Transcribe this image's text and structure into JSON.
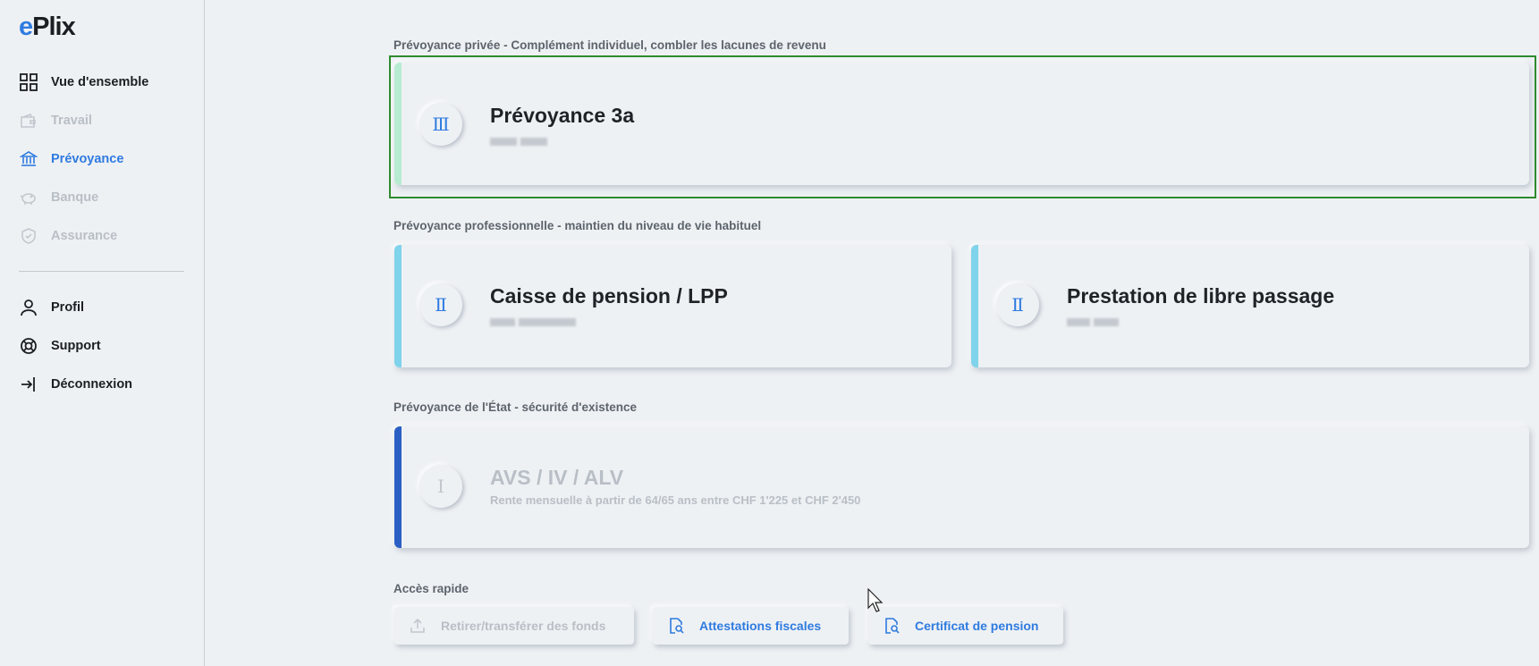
{
  "brand": {
    "logo_e": "e",
    "logo_rest": "Plix",
    "accent_color": "#2f7be0",
    "strip_color": "#a6e22a"
  },
  "sidebar": {
    "items": [
      {
        "label": "Vue d'ensemble",
        "icon": "grid-icon",
        "state": "normal"
      },
      {
        "label": "Travail",
        "icon": "wallet-icon",
        "state": "disabled"
      },
      {
        "label": "Prévoyance",
        "icon": "bank-icon",
        "state": "active"
      },
      {
        "label": "Banque",
        "icon": "piggy-bank-icon",
        "state": "disabled"
      },
      {
        "label": "Assurance",
        "icon": "shield-check-icon",
        "state": "disabled"
      }
    ],
    "bottom_items": [
      {
        "label": "Profil",
        "icon": "user-icon"
      },
      {
        "label": "Support",
        "icon": "lifebuoy-icon"
      },
      {
        "label": "Déconnexion",
        "icon": "logout-icon"
      }
    ]
  },
  "sections": {
    "private": {
      "label": "Prévoyance privée - Complément individuel, combler les lacunes de revenu",
      "card": {
        "title": "Prévoyance 3a",
        "pillar": "Ⅲ",
        "bar_color": "#b8ecd2"
      }
    },
    "professional": {
      "label": "Prévoyance professionnelle - maintien du niveau de vie habituel",
      "cards": [
        {
          "title": "Caisse de pension / LPP",
          "pillar": "Ⅱ",
          "bar_color": "#7fd3ea"
        },
        {
          "title": "Prestation de libre passage",
          "pillar": "Ⅱ",
          "bar_color": "#7fd3ea"
        }
      ]
    },
    "state": {
      "label": "Prévoyance de l'État - sécurité d'existence",
      "card": {
        "title": "AVS / IV / ALV",
        "pillar": "Ⅰ",
        "subtitle": "Rente mensuelle à partir de 64/65 ans entre CHF 1'225 et CHF 2'450",
        "bar_color": "#2b5fc4"
      }
    }
  },
  "quick_access": {
    "label": "Accès rapide",
    "buttons": [
      {
        "label": "Retirer/transférer des fonds",
        "icon": "upload-icon",
        "state": "disabled"
      },
      {
        "label": "Attestations fiscales",
        "icon": "document-search-icon",
        "state": "enabled"
      },
      {
        "label": "Certificat de pension",
        "icon": "document-search-icon",
        "state": "enabled"
      }
    ]
  }
}
